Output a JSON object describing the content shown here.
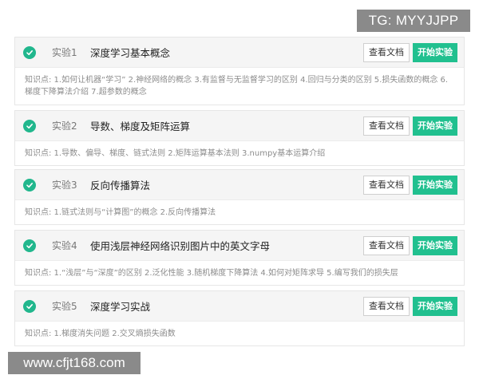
{
  "watermarks": {
    "top": "TG: MYYJJPP",
    "bottom": "www.cfjt168.com"
  },
  "buttons": {
    "doc_label": "查看文档",
    "start_label": "开始实验"
  },
  "colors": {
    "accent": "#21c08f",
    "check": "#21b78d"
  },
  "experiments": [
    {
      "num": "实验1",
      "title": "深度学习基本概念",
      "knowledge": "知识点: 1.如何让机器“学习” 2.神经网络的概念 3.有监督与无监督学习的区别 4.回归与分类的区别 5.损失函数的概念 6.梯度下降算法介绍 7.超参数的概念"
    },
    {
      "num": "实验2",
      "title": "导数、梯度及矩阵运算",
      "knowledge": "知识点: 1.导数、偏导、梯度、链式法则 2.矩阵运算基本法则 3.numpy基本运算介绍"
    },
    {
      "num": "实验3",
      "title": "反向传播算法",
      "knowledge": "知识点: 1.链式法则与“计算图”的概念 2.反向传播算法"
    },
    {
      "num": "实验4",
      "title": "使用浅层神经网络识别图片中的英文字母",
      "knowledge": "知识点: 1.“浅层”与“深度”的区别 2.泛化性能 3.随机梯度下降算法 4.如何对矩阵求导 5.编写我们的损失层"
    },
    {
      "num": "实验5",
      "title": "深度学习实战",
      "knowledge": "知识点: 1.梯度消失问题 2.交叉熵损失函数"
    }
  ]
}
